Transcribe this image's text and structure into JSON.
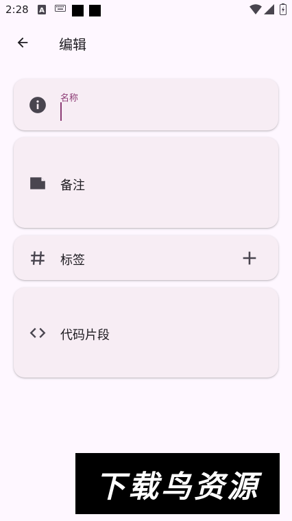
{
  "status_bar": {
    "time": "2:28"
  },
  "app_bar": {
    "title": "编辑",
    "back_icon": "arrow-back-icon"
  },
  "name_field": {
    "label": "名称",
    "value": "",
    "icon": "info-icon",
    "accent_color": "#8C3B74"
  },
  "note_card": {
    "label": "备注",
    "icon": "note-label-icon"
  },
  "tags_card": {
    "label": "标签",
    "icon": "hash-icon",
    "add_icon": "plus-icon"
  },
  "code_card": {
    "label": "代码片段",
    "icon": "code-icon"
  },
  "watermark": {
    "text": "下载鸟资源"
  },
  "colors": {
    "background": "#FEF7FF",
    "card": "#F7EDF4",
    "accent": "#8C3B74",
    "icon": "#49454F"
  }
}
